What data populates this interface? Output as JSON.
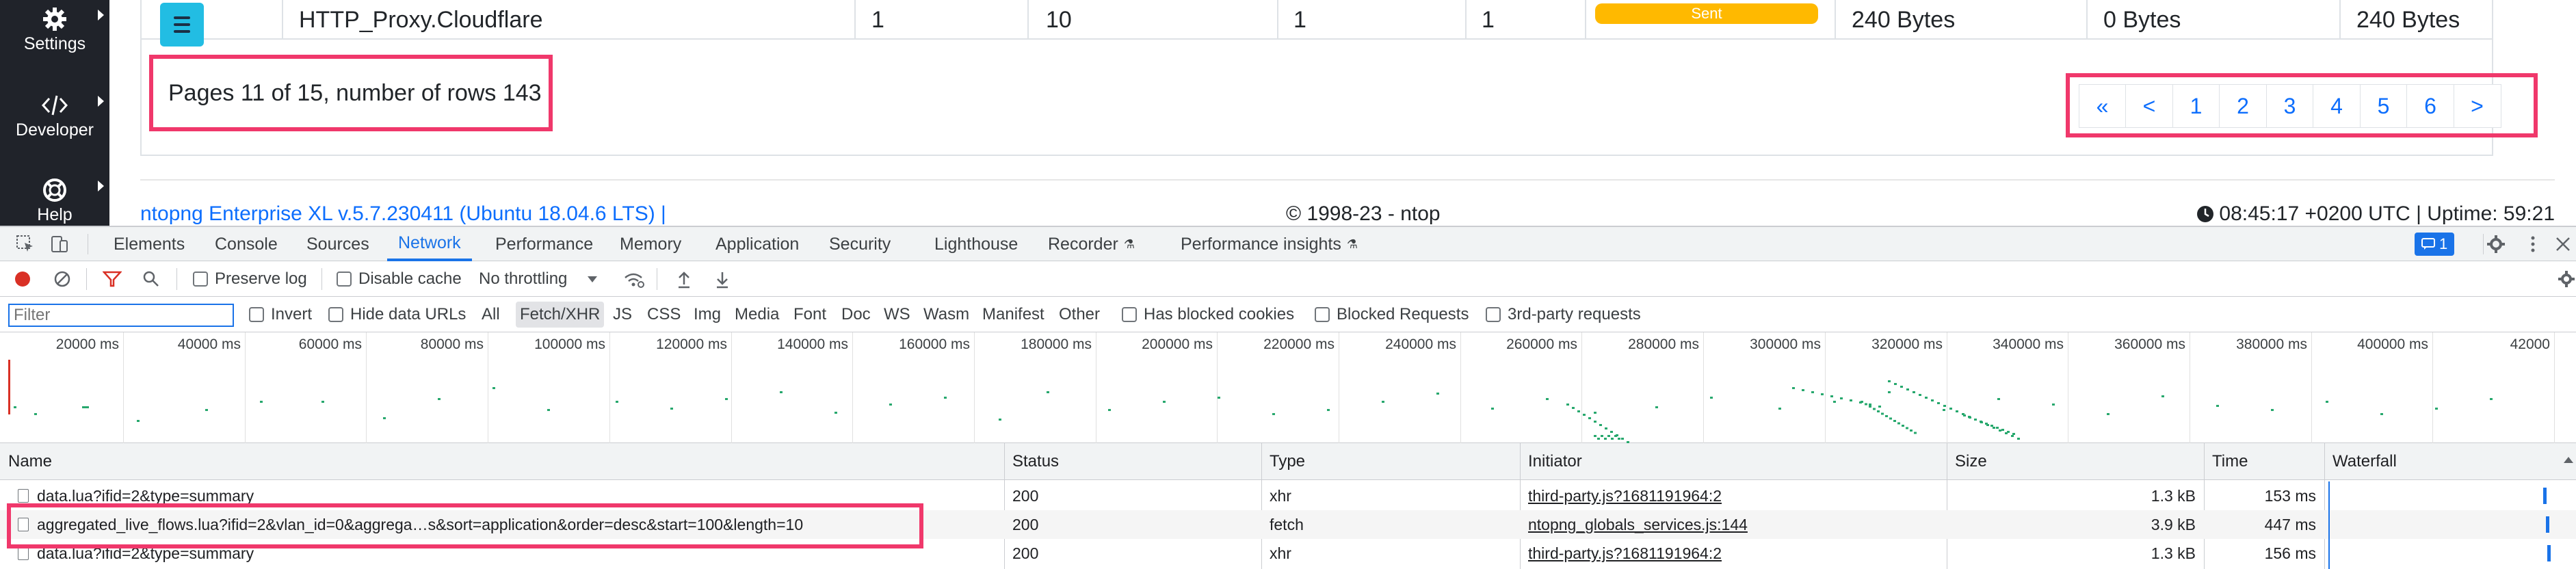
{
  "sidebar": {
    "items": [
      {
        "label": "Settings",
        "icon": "gear-icon"
      },
      {
        "label": "Developer",
        "icon": "code-icon"
      },
      {
        "label": "Help",
        "icon": "lifebuoy-icon"
      }
    ]
  },
  "flows_row": {
    "application": "HTTP_Proxy.Cloudflare",
    "c1": "1",
    "c2": "10",
    "c3": "1",
    "c4": "1",
    "status_badge": "Sent",
    "bytes1": "240 Bytes",
    "bytes2": "0 Bytes",
    "bytes3": "240 Bytes"
  },
  "pagination": {
    "info": "Pages 11 of 15, number of rows 143",
    "first": "«",
    "prev": "<",
    "pages": [
      "1",
      "2",
      "3",
      "4",
      "5",
      "6"
    ],
    "next": ">"
  },
  "footer": {
    "version": "ntopng Enterprise XL v.5.7.230411 (Ubuntu 18.04.6 LTS) |",
    "copyright": "© 1998-23 - ntop",
    "uptime": "08:45:17 +0200 UTC | Uptime: 59:21"
  },
  "devtools": {
    "tabs": [
      "Elements",
      "Console",
      "Sources",
      "Network",
      "Performance",
      "Memory",
      "Application",
      "Security",
      "Lighthouse",
      "Recorder",
      "Performance insights"
    ],
    "active_tab": "Network",
    "issues_count": "1",
    "toolbar": {
      "preserve_log": "Preserve log",
      "disable_cache": "Disable cache",
      "throttling": "No throttling"
    },
    "filter": {
      "placeholder": "Filter",
      "invert": "Invert",
      "hide_data_urls": "Hide data URLs",
      "types": [
        "All",
        "Fetch/XHR",
        "JS",
        "CSS",
        "Img",
        "Media",
        "Font",
        "Doc",
        "WS",
        "Wasm",
        "Manifest",
        "Other"
      ],
      "selected_type": "Fetch/XHR",
      "has_blocked_cookies": "Has blocked cookies",
      "blocked_requests": "Blocked Requests",
      "third_party": "3rd-party requests"
    },
    "timeline_ticks": [
      "20000 ms",
      "40000 ms",
      "60000 ms",
      "80000 ms",
      "100000 ms",
      "120000 ms",
      "140000 ms",
      "160000 ms",
      "180000 ms",
      "200000 ms",
      "220000 ms",
      "240000 ms",
      "260000 ms",
      "280000 ms",
      "300000 ms",
      "320000 ms",
      "340000 ms",
      "360000 ms",
      "380000 ms",
      "400000 ms",
      "42000"
    ],
    "table": {
      "headers": [
        "Name",
        "Status",
        "Type",
        "Initiator",
        "Size",
        "Time",
        "Waterfall"
      ],
      "rows": [
        {
          "name": "data.lua?ifid=2&type=summary",
          "status": "200",
          "type": "xhr",
          "initiator": "third-party.js?1681191964:2",
          "size": "1.3 kB",
          "time": "153 ms"
        },
        {
          "name": "aggregated_live_flows.lua?ifid=2&vlan_id=0&aggrega…s&sort=application&order=desc&start=100&length=10",
          "status": "200",
          "type": "fetch",
          "initiator": "ntopng_globals_services.js:144",
          "size": "3.9 kB",
          "time": "447 ms"
        },
        {
          "name": "data.lua?ifid=2&type=summary",
          "status": "200",
          "type": "xhr",
          "initiator": "third-party.js?1681191964:2",
          "size": "1.3 kB",
          "time": "156 ms"
        }
      ]
    }
  },
  "colors": {
    "highlight": "#f0386b",
    "accent": "#1a73e8",
    "badge": "#ffb900",
    "menu_button": "#22bde3",
    "sidebar": "#20232a"
  }
}
